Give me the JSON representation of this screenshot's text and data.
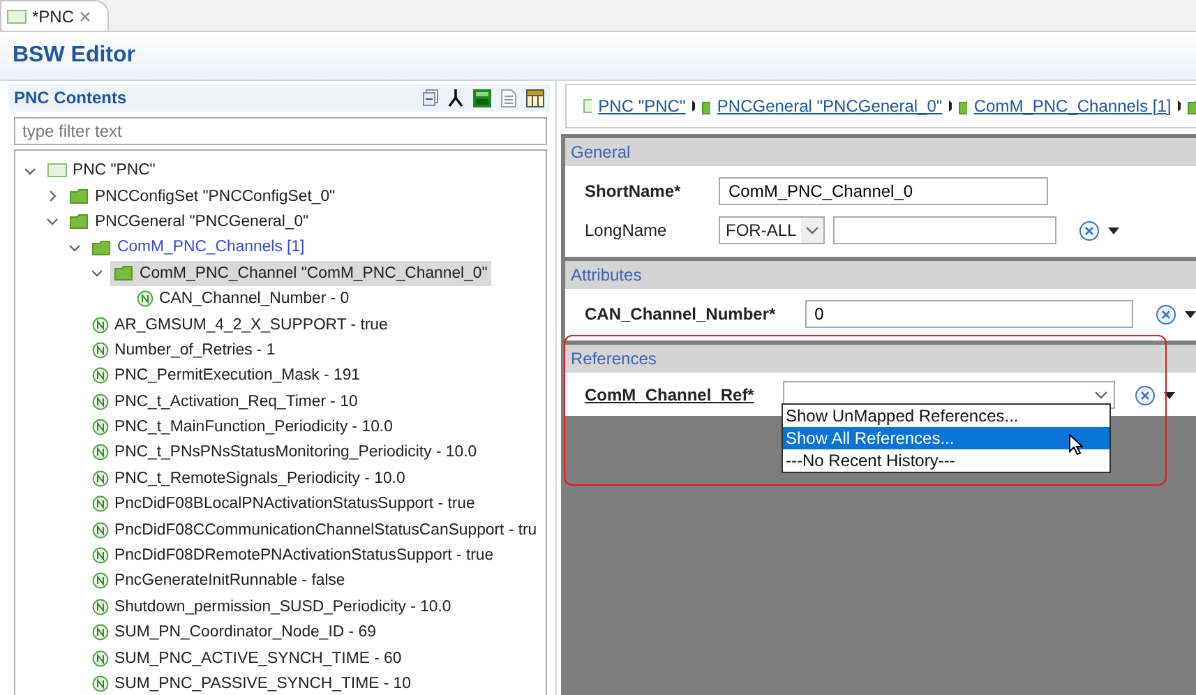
{
  "editor_tab": {
    "title": "*PNC"
  },
  "editor": {
    "title": "BSW Editor"
  },
  "contents": {
    "title": "PNC Contents",
    "filter": {
      "placeholder": "type filter text"
    },
    "tree": [
      {
        "label": "PNC \"PNC\"",
        "kind": "module",
        "expanded": true,
        "selected": false,
        "children": [
          {
            "label": "PNCConfigSet \"PNCConfigSet_0\"",
            "kind": "folder",
            "expanded": false,
            "selected": false
          },
          {
            "label": "PNCGeneral \"PNCGeneral_0\"",
            "kind": "folder",
            "expanded": true,
            "selected": false,
            "children": [
              {
                "label": "ComM_PNC_Channels [1]",
                "kind": "folder-list",
                "expanded": true,
                "selected": false,
                "children": [
                  {
                    "label": "ComM_PNC_Channel \"ComM_PNC_Channel_0\"",
                    "kind": "folder",
                    "expanded": true,
                    "selected": true,
                    "children": [
                      {
                        "label": "CAN_Channel_Number - 0",
                        "kind": "param",
                        "selected": false
                      }
                    ]
                  }
                ]
              },
              {
                "label": "AR_GMSUM_4_2_X_SUPPORT - true",
                "kind": "param",
                "selected": false
              },
              {
                "label": "Number_of_Retries - 1",
                "kind": "param",
                "selected": false
              },
              {
                "label": "PNC_PermitExecution_Mask - 191",
                "kind": "param",
                "selected": false
              },
              {
                "label": "PNC_t_Activation_Req_Timer - 10",
                "kind": "param",
                "selected": false
              },
              {
                "label": "PNC_t_MainFunction_Periodicity - 10.0",
                "kind": "param",
                "selected": false
              },
              {
                "label": "PNC_t_PNsPNsStatusMonitoring_Periodicity - 10.0",
                "kind": "param",
                "selected": false
              },
              {
                "label": "PNC_t_RemoteSignals_Periodicity - 10.0",
                "kind": "param",
                "selected": false
              },
              {
                "label": "PncDidF08BLocalPNActivationStatusSupport - true",
                "kind": "param",
                "selected": false
              },
              {
                "label": "PncDidF08CCommunicationChannelStatusCanSupport - tru",
                "kind": "param",
                "selected": false
              },
              {
                "label": "PncDidF08DRemotePNActivationStatusSupport - true",
                "kind": "param",
                "selected": false
              },
              {
                "label": "PncGenerateInitRunnable - false",
                "kind": "param",
                "selected": false
              },
              {
                "label": "Shutdown_permission_SUSD_Periodicity - 10.0",
                "kind": "param",
                "selected": false
              },
              {
                "label": "SUM_PN_Coordinator_Node_ID - 69",
                "kind": "param",
                "selected": false
              },
              {
                "label": "SUM_PNC_ACTIVE_SYNCH_TIME - 60",
                "kind": "param",
                "selected": false
              },
              {
                "label": "SUM_PNC_PASSIVE_SYNCH_TIME - 10",
                "kind": "param",
                "selected": false
              }
            ]
          }
        ]
      }
    ]
  },
  "breadcrumb": [
    {
      "label": "PNC \"PNC\"",
      "kind": "module"
    },
    {
      "label": "PNCGeneral \"PNCGeneral_0\"",
      "kind": "folder"
    },
    {
      "label": "ComM_PNC_Channels [1]",
      "kind": "folder"
    }
  ],
  "general": {
    "title": "General",
    "short_name": {
      "label": "ShortName*",
      "value": "ComM_PNC_Channel_0"
    },
    "long_name": {
      "label": "LongName",
      "language": "FOR-ALL"
    }
  },
  "attributes": {
    "title": "Attributes",
    "fields": [
      {
        "label": "CAN_Channel_Number*",
        "value": "0"
      }
    ]
  },
  "references": {
    "title": "References",
    "fields": [
      {
        "label": "ComM_Channel_Ref*",
        "open": true,
        "options": [
          {
            "label": "Show UnMapped References...",
            "selected": false
          },
          {
            "label": "Show All References...",
            "selected": true
          },
          {
            "label": "---No Recent History---",
            "selected": false
          }
        ]
      }
    ]
  }
}
